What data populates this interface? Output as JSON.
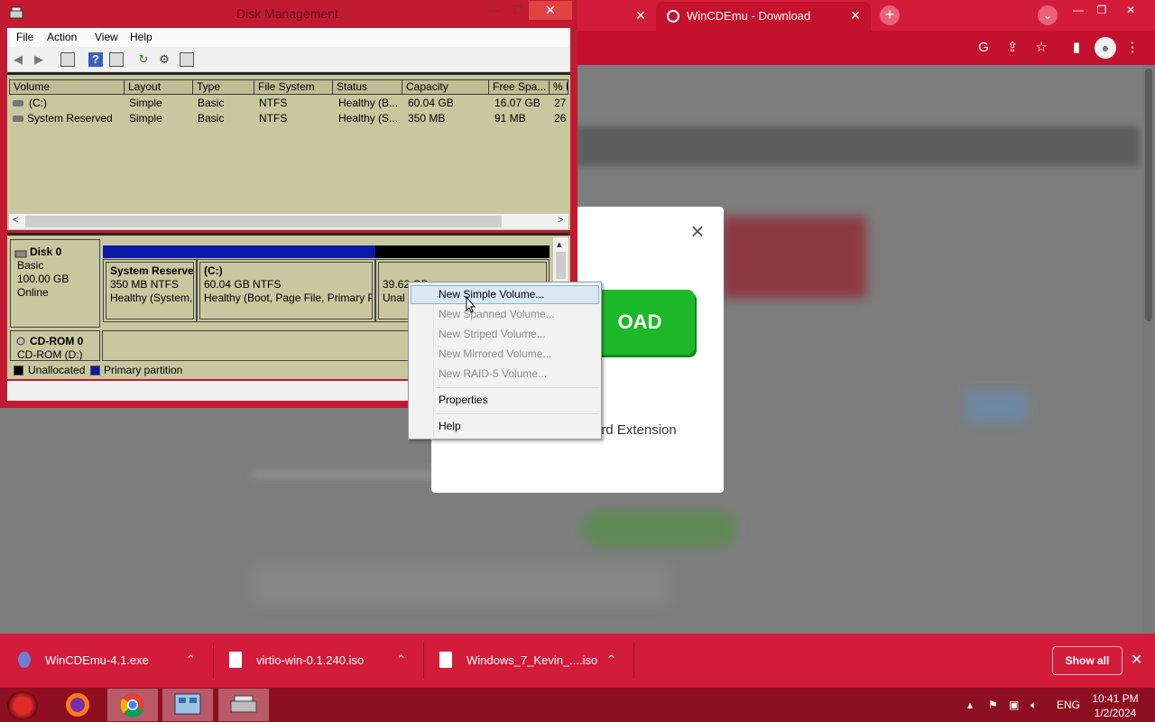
{
  "browser": {
    "active_tab_title": "WinCDEmu - Download",
    "modal": {
      "download_label": "OAD",
      "quote_text": "\"",
      "extension_text": "ard Extension"
    },
    "downloads": [
      {
        "name": "WinCDEmu-4.1.exe"
      },
      {
        "name": "virtio-win-0.1.240.iso"
      },
      {
        "name": "Windows_7_Kevin_....iso"
      }
    ],
    "show_all_label": "Show all"
  },
  "disk_management": {
    "title": "Disk Management",
    "menu": [
      "File",
      "Action",
      "View",
      "Help"
    ],
    "columns": [
      "Volume",
      "Layout",
      "Type",
      "File System",
      "Status",
      "Capacity",
      "Free Spa...",
      "% F"
    ],
    "volumes": [
      {
        "volume": "(C:)",
        "layout": "Simple",
        "type": "Basic",
        "fs": "NTFS",
        "status": "Healthy (B...",
        "capacity": "60.04 GB",
        "free": "16.07 GB",
        "pct": "27"
      },
      {
        "volume": "System Reserved",
        "layout": "Simple",
        "type": "Basic",
        "fs": "NTFS",
        "status": "Healthy (S...",
        "capacity": "350 MB",
        "free": "91 MB",
        "pct": "26"
      }
    ],
    "disk0": {
      "name": "Disk 0",
      "kind": "Basic",
      "size": "100.00 GB",
      "state": "Online",
      "partitions": [
        {
          "title": "System Reserve",
          "size": "350 MB NTFS",
          "status": "Healthy (System,"
        },
        {
          "title": "(C:)",
          "size": "60.04 GB NTFS",
          "status": "Healthy (Boot, Page File, Primary P"
        },
        {
          "title": "",
          "size": "39.62 GB",
          "status": "Unal"
        }
      ]
    },
    "cdrom": {
      "name": "CD-ROM 0",
      "sub": "CD-ROM (D:)"
    },
    "legend": {
      "unallocated": "Unallocated",
      "primary": "Primary partition"
    }
  },
  "context_menu": {
    "items": [
      {
        "label": "New Simple Volume...",
        "enabled": true
      },
      {
        "label": "New Spanned Volume...",
        "enabled": false
      },
      {
        "label": "New Striped Volume...",
        "enabled": false
      },
      {
        "label": "New Mirrored Volume...",
        "enabled": false
      },
      {
        "label": "New RAID-5 Volume...",
        "enabled": false
      },
      {
        "label": "Properties",
        "enabled": true
      },
      {
        "label": "Help",
        "enabled": true
      }
    ]
  },
  "taskbar": {
    "language": "ENG",
    "time": "10:41 PM",
    "date": "1/2/2024"
  },
  "colors": {
    "chrome_red": "#d31c3a",
    "taskbar": "#8e0f22",
    "unallocated": "#000000",
    "primary_partition": "#0a1aa8",
    "download_green": "#1db82a"
  }
}
